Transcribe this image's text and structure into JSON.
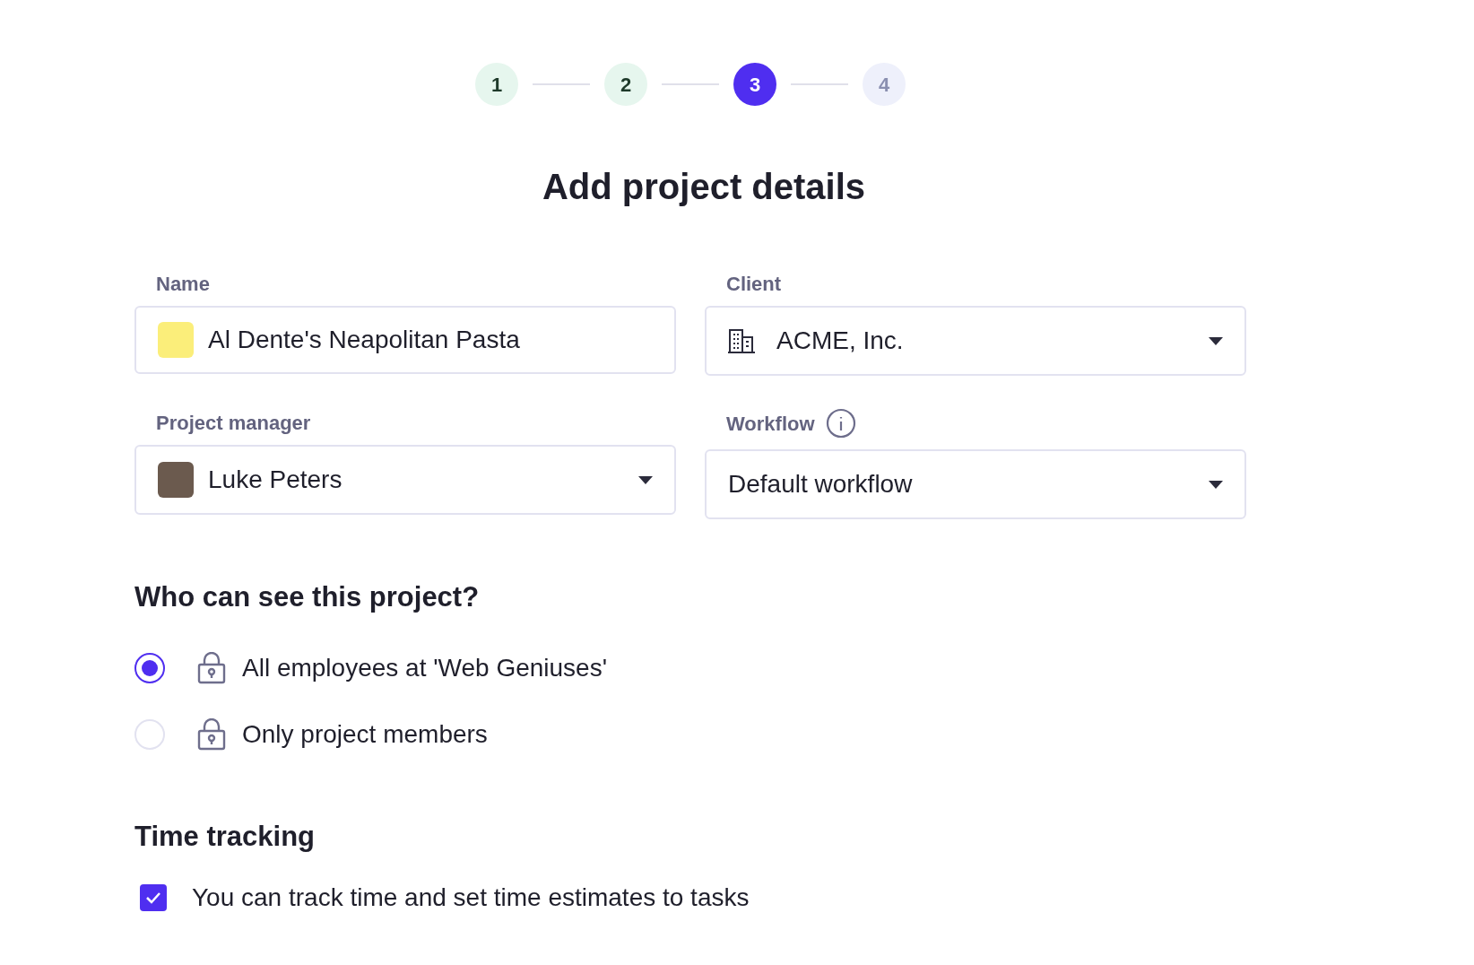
{
  "steps": [
    {
      "label": "1",
      "completed": true,
      "selected": false
    },
    {
      "label": "2",
      "completed": true,
      "selected": false
    },
    {
      "label": "3",
      "completed": false,
      "selected": true
    },
    {
      "label": "4",
      "completed": false,
      "selected": false
    }
  ],
  "title": "Add project details",
  "fields": [
    {
      "kind": "name",
      "label": "Name",
      "value": "Al Dente's Neapolitan Pasta",
      "color": "#fbee7a"
    },
    {
      "kind": "client",
      "label": "Client",
      "value": "ACME, Inc."
    },
    {
      "kind": "manager",
      "label": "Project manager",
      "value": "Luke Peters"
    },
    {
      "kind": "workflow",
      "label": "Workflow",
      "value": "Default workflow"
    }
  ],
  "visibility": {
    "heading": "Who can see this project?",
    "options": [
      {
        "label": "All employees at 'Web Geniuses'",
        "selected": true
      },
      {
        "label": "Only project members",
        "selected": false
      }
    ]
  },
  "time_tracking": {
    "heading": "Time tracking",
    "label": "You can track time and set time estimates to tasks",
    "checked": true
  }
}
